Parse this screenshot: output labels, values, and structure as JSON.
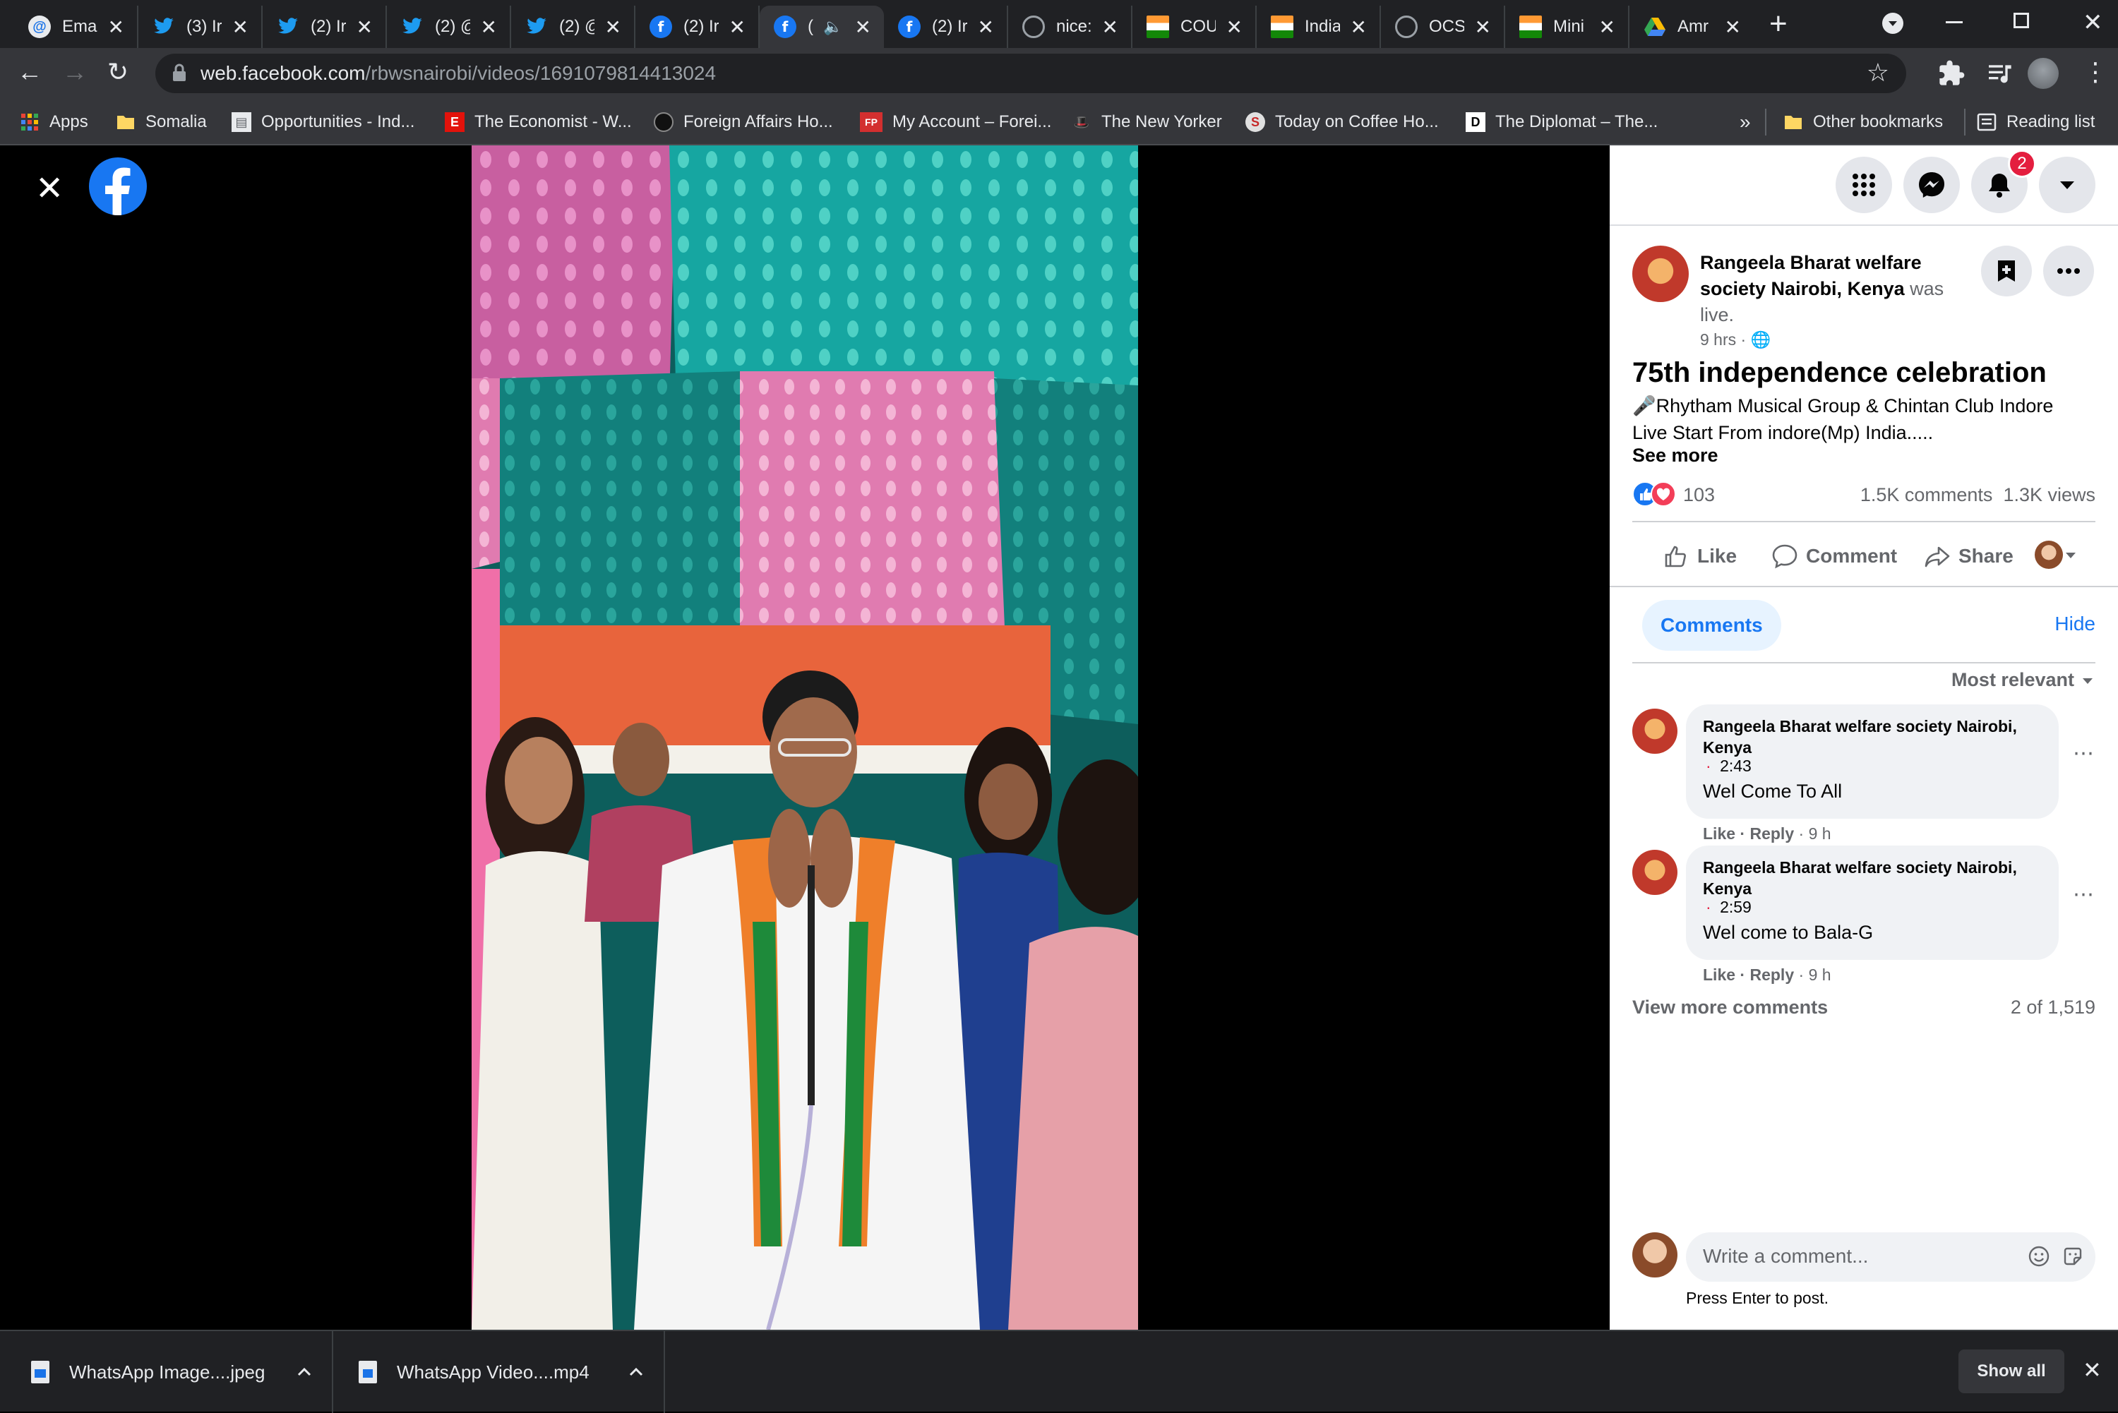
{
  "browser": {
    "tabs": [
      {
        "title": "Ema",
        "icon": "at-icon",
        "color": "#1a73e8"
      },
      {
        "title": "(3) Ir",
        "icon": "twitter-icon",
        "color": "#1d9bf0"
      },
      {
        "title": "(2) Ir",
        "icon": "twitter-icon",
        "color": "#1d9bf0"
      },
      {
        "title": "(2) @",
        "icon": "twitter-icon",
        "color": "#1d9bf0"
      },
      {
        "title": "(2) @",
        "icon": "twitter-icon",
        "color": "#1d9bf0"
      },
      {
        "title": "(2) Ir",
        "icon": "facebook-icon",
        "color": "#1877f2"
      },
      {
        "title": "(",
        "icon": "facebook-icon",
        "color": "#1877f2",
        "active": true
      },
      {
        "title": "(2) Ir",
        "icon": "facebook-icon",
        "color": "#1877f2"
      },
      {
        "title": "nice:",
        "icon": "globe-icon",
        "color": "#9aa0a6"
      },
      {
        "title": "COU",
        "icon": "mea-icon",
        "color": "#f4b400"
      },
      {
        "title": "India",
        "icon": "mea-icon",
        "color": "#f4b400"
      },
      {
        "title": "OCS",
        "icon": "globe-icon",
        "color": "#9aa0a6"
      },
      {
        "title": "Mini",
        "icon": "mea-icon",
        "color": "#f4b400"
      },
      {
        "title": "Amr",
        "icon": "drive-icon",
        "color": "#34a853"
      }
    ],
    "url_host": "web.facebook.com",
    "url_path": "/rbwsnairobi/videos/1691079814413024",
    "bookmarks": [
      {
        "label": "Apps",
        "icon": "apps-grid-icon"
      },
      {
        "label": "Somalia",
        "icon": "folder-icon"
      },
      {
        "label": "Opportunities - Ind...",
        "icon": "emblem-icon"
      },
      {
        "label": "The Economist - W...",
        "icon": "economist-icon"
      },
      {
        "label": "Foreign Affairs Ho...",
        "icon": "globe-icon"
      },
      {
        "label": "My Account – Forei...",
        "icon": "fp-icon"
      },
      {
        "label": "The New Yorker",
        "icon": "new-yorker-icon"
      },
      {
        "label": "Today on Coffee Ho...",
        "icon": "coffee-house-icon"
      },
      {
        "label": "The Diplomat – The...",
        "icon": "diplomat-icon"
      }
    ],
    "bookmarks_more": "»",
    "other_bookmarks": "Other bookmarks",
    "reading_list": "Reading list",
    "economist_letter": "E",
    "fp_letters": "FP",
    "coffee_letter": "S",
    "diplomat_letter": "D"
  },
  "fb": {
    "notifications_count": "2",
    "post": {
      "author": "Rangeela Bharat welfare society Nairobi, Kenya",
      "author_suffix": "was live.",
      "time": "9 hrs ·",
      "title": "75th independence celebration",
      "body_line1": "🎤Rhytham Musical Group & Chintan Club Indore",
      "body_line2": "Live Start From indore(Mp) India.....",
      "see_more": "See more",
      "reactions_count": "103",
      "comments_count": "1.5K comments",
      "views": "1.3K views"
    },
    "actions": {
      "like": "Like",
      "comment": "Comment",
      "share": "Share"
    },
    "comments_tab": "Comments",
    "hide": "Hide",
    "sort": "Most relevant",
    "comments": [
      {
        "author": "Rangeela Bharat welfare society Nairobi, Kenya",
        "timestamp": "2:43",
        "text": "Wel Come To All",
        "like": "Like",
        "reply": "Reply",
        "age": "· 9 h"
      },
      {
        "author": "Rangeela Bharat welfare society Nairobi, Kenya",
        "timestamp": "2:59",
        "text": "Wel come to Bala-G",
        "like": "Like",
        "reply": "Reply",
        "age": "· 9 h"
      }
    ],
    "view_more": "View more comments",
    "count_label": "2 of 1,519",
    "write_placeholder": "Write a comment...",
    "press_enter": "Press Enter to post."
  },
  "downloads": [
    {
      "name": "WhatsApp Image....jpeg",
      "icon": "image-file-icon"
    },
    {
      "name": "WhatsApp Video....mp4",
      "icon": "video-file-icon"
    }
  ],
  "show_all": "Show all",
  "colors": {
    "facebook_blue": "#1877f2",
    "chrome_dark": "#202124",
    "chrome_toolbar": "#35363a",
    "notification_red": "#e41e3f"
  }
}
